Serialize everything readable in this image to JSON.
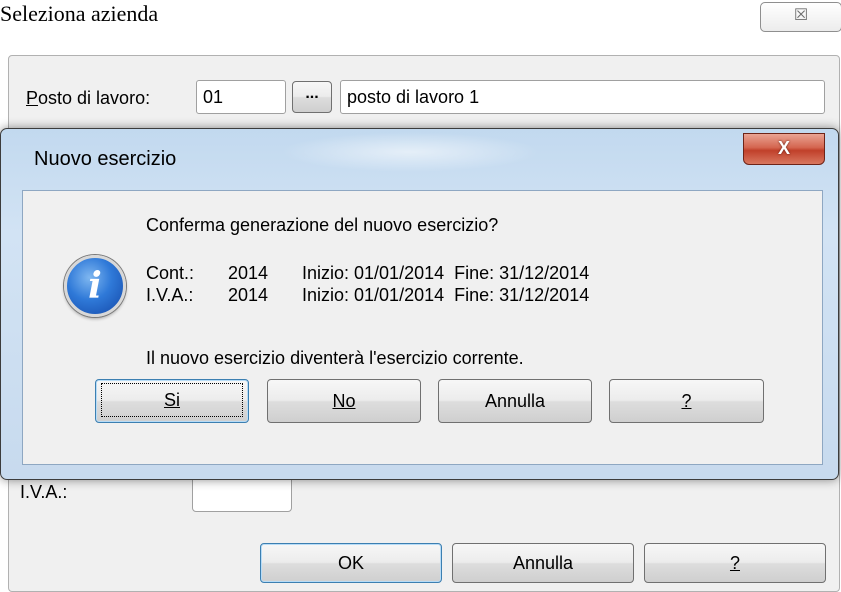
{
  "background_window": {
    "title": "Seleziona azienda",
    "close_glyph": "☒",
    "posto_label": "Posto di lavoro:",
    "posto_label_accel": "P",
    "posto_label_rest": "osto di lavoro:",
    "posto_code": "01",
    "browse_label": "...",
    "posto_name": "posto di lavoro 1",
    "iva_label": "I.V.A.:",
    "buttons": {
      "ok": "OK",
      "cancel": "Annulla",
      "help": "?"
    }
  },
  "dialog": {
    "title": "Nuovo esercizio",
    "close_glyph": "X",
    "question": "Conferma generazione del nuovo esercizio?",
    "rows": [
      {
        "label": "Cont.:",
        "year": "2014",
        "range": "Inizio: 01/01/2014  Fine: 31/12/2014"
      },
      {
        "label": "I.V.A.:",
        "year": "2014",
        "range": "Inizio: 01/01/2014  Fine: 31/12/2014"
      }
    ],
    "note": "Il nuovo esercizio diventerà l'esercizio corrente.",
    "buttons": {
      "yes": "Si",
      "no": "No",
      "cancel": "Annulla",
      "help": "?"
    }
  },
  "icons": {
    "dialog_icon": "info-icon"
  }
}
